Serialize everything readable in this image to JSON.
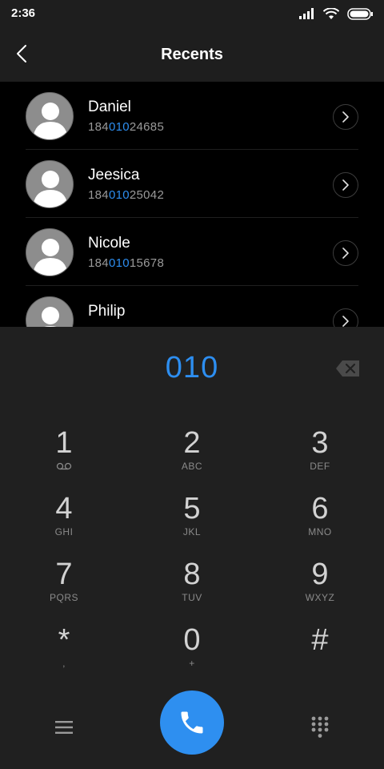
{
  "status_bar": {
    "time": "2:36"
  },
  "header": {
    "title": "Recents"
  },
  "recents": [
    {
      "name": "Daniel",
      "number_prefix": "184",
      "number_match": "010",
      "number_suffix": "24685"
    },
    {
      "name": "Jeesica",
      "number_prefix": "184",
      "number_match": "010",
      "number_suffix": "25042"
    },
    {
      "name": "Nicole",
      "number_prefix": "184",
      "number_match": "010",
      "number_suffix": "15678"
    },
    {
      "name": "Philip",
      "number_prefix": "",
      "number_match": "",
      "number_suffix": ""
    }
  ],
  "dialer": {
    "input_value": "010",
    "keys": [
      {
        "digit": "1",
        "letters": "",
        "sub_icon": "voicemail-icon"
      },
      {
        "digit": "2",
        "letters": "ABC"
      },
      {
        "digit": "3",
        "letters": "DEF"
      },
      {
        "digit": "4",
        "letters": "GHI"
      },
      {
        "digit": "5",
        "letters": "JKL"
      },
      {
        "digit": "6",
        "letters": "MNO"
      },
      {
        "digit": "7",
        "letters": "PQRS"
      },
      {
        "digit": "8",
        "letters": "TUV"
      },
      {
        "digit": "9",
        "letters": "WXYZ"
      },
      {
        "digit": "*",
        "letters": ","
      },
      {
        "digit": "0",
        "letters": "+"
      },
      {
        "digit": "#",
        "letters": ""
      }
    ]
  },
  "colors": {
    "accent": "#2e8ff0",
    "background": "#000000",
    "panel": "#202020"
  },
  "icons": {
    "back": "chevron-left-icon",
    "detail": "chevron-right-icon",
    "backspace": "backspace-icon",
    "menu": "menu-icon",
    "call": "phone-icon",
    "keypad": "dialpad-icon"
  }
}
